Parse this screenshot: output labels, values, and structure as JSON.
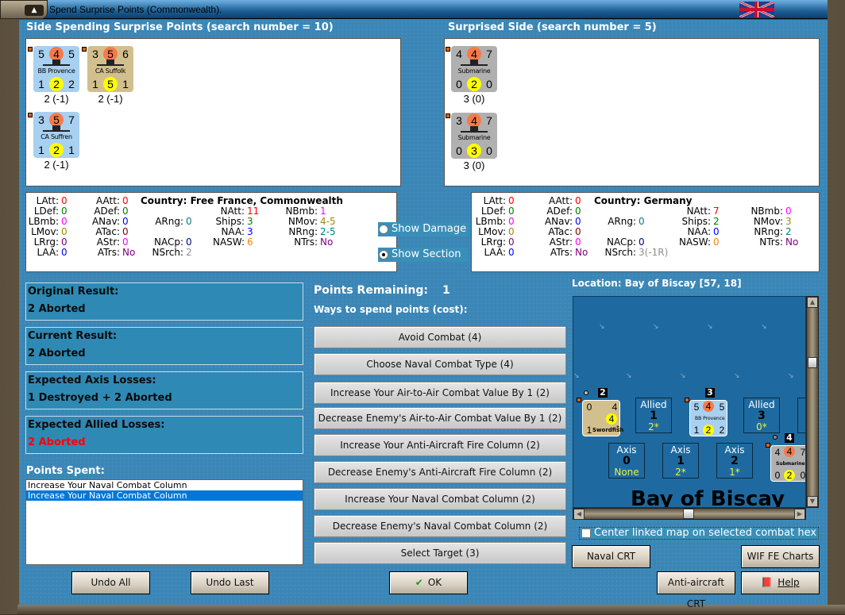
{
  "window": {
    "title": "Spend Surprise Points (Commonwealth)."
  },
  "spending": {
    "heading": "Side Spending Surprise Points (search number = 10)",
    "units": [
      {
        "tl": "5",
        "tm": "4",
        "tr": "5",
        "bl": "1",
        "bm": "2",
        "br": "2",
        "name": "BB Provence",
        "bg": "#a8d0f0",
        "footer": "2 (-1)"
      },
      {
        "tl": "3",
        "tm": "5",
        "tr": "6",
        "bl": "1",
        "bm": "5",
        "br": "1",
        "name": "CA Suffolk",
        "bg": "#d2bf8e",
        "footer": "2 (-1)"
      },
      {
        "tl": "3",
        "tm": "5",
        "tr": "7",
        "bl": "1",
        "bm": "2",
        "br": "1",
        "name": "CA Suffren",
        "bg": "#a8d0f0",
        "footer": "2 (-1)"
      }
    ],
    "country": "Country: Free France, Commonwealth",
    "stats": [
      [
        "LAtt",
        "0",
        "#ff0000"
      ],
      [
        "LDef",
        "0",
        "#008000"
      ],
      [
        "LBmb",
        "0",
        "#ff00ff"
      ],
      [
        "LMov",
        "0",
        "#a08a00"
      ],
      [
        "LRrg",
        "0",
        "#800080"
      ],
      [
        "LAA",
        "0",
        "#0000ff"
      ],
      [
        "AAtt",
        "0",
        "#ff0000"
      ],
      [
        "ADef",
        "0",
        "#008000"
      ],
      [
        "ANav",
        "0",
        "#0000ff"
      ],
      [
        "ATac",
        "0",
        "#800000"
      ],
      [
        "AStr",
        "0",
        "#ff00ff"
      ],
      [
        "ATrs",
        "No",
        "#800080"
      ],
      [
        "ARng",
        "0",
        "#008080"
      ],
      [
        "NACp",
        "0",
        "#000080"
      ],
      [
        "NSrch",
        "2",
        "#909090"
      ],
      [
        "NAtt",
        "11",
        "#ff0000"
      ],
      [
        "Ships",
        "3",
        "#008000"
      ],
      [
        "NAA",
        "3",
        "#0000ff"
      ],
      [
        "NASW",
        "6",
        "#ff8000"
      ],
      [
        "NBmb",
        "1",
        "#ff00ff"
      ],
      [
        "NMov",
        "4-5",
        "#a08a00"
      ],
      [
        "NRng",
        "2-5",
        "#008080"
      ],
      [
        "NTrs",
        "No",
        "#800080"
      ]
    ]
  },
  "surprised": {
    "heading": "Surprised Side (search number = 5)",
    "units": [
      {
        "tl": "4",
        "tm": "4",
        "tr": "7",
        "bl": "0",
        "bm": "2",
        "br": "0",
        "name": "Submarine",
        "bg": "#b0b0b0",
        "footer": "3 (0)"
      },
      {
        "tl": "3",
        "tm": "4",
        "tr": "7",
        "bl": "0",
        "bm": "3",
        "br": "0",
        "name": "Submarine",
        "bg": "#b0b0b0",
        "footer": "3 (0)"
      }
    ],
    "country": "Country: Germany",
    "stats": [
      [
        "LAtt",
        "0",
        "#ff0000"
      ],
      [
        "LDef",
        "0",
        "#008000"
      ],
      [
        "LBmb",
        "0",
        "#ff00ff"
      ],
      [
        "LMov",
        "0",
        "#a08a00"
      ],
      [
        "LRrg",
        "0",
        "#800080"
      ],
      [
        "LAA",
        "0",
        "#0000ff"
      ],
      [
        "AAtt",
        "0",
        "#ff0000"
      ],
      [
        "ADef",
        "0",
        "#008000"
      ],
      [
        "ANav",
        "0",
        "#0000ff"
      ],
      [
        "ATac",
        "0",
        "#800000"
      ],
      [
        "AStr",
        "0",
        "#ff00ff"
      ],
      [
        "ATrs",
        "No",
        "#800080"
      ],
      [
        "ARng",
        "0",
        "#008080"
      ],
      [
        "NACp",
        "0",
        "#000080"
      ],
      [
        "NSrch",
        "3(-1R)",
        "#909090"
      ],
      [
        "NAtt",
        "7",
        "#ff0000"
      ],
      [
        "Ships",
        "2",
        "#008000"
      ],
      [
        "NAA",
        "0",
        "#0000ff"
      ],
      [
        "NASW",
        "0",
        "#ff8000"
      ],
      [
        "NBmb",
        "0",
        "#ff00ff"
      ],
      [
        "NMov",
        "3",
        "#a08a00"
      ],
      [
        "NRng",
        "2",
        "#008080"
      ],
      [
        "NTrs",
        "No",
        "#800080"
      ]
    ]
  },
  "view": {
    "show_damage": "Show Damage",
    "show_section": "Show Section",
    "selected": "Show Section"
  },
  "results": [
    {
      "label": "Original Result:",
      "value": "2 Aborted",
      "color": "#0a0a0a"
    },
    {
      "label": "Current Result:",
      "value": "2 Aborted",
      "color": "#0a0a0a"
    },
    {
      "label": "Expected Axis Losses:",
      "value": "1 Destroyed + 2 Aborted",
      "color": "#0a0a0a"
    },
    {
      "label": "Expected Allied Losses:",
      "value": "2 Aborted",
      "color": "#ff0000"
    }
  ],
  "points_spent": {
    "label": "Points Spent:",
    "items": [
      "Increase Your Naval Combat Column",
      "Increase Your Naval Combat Column"
    ],
    "selected_index": 1
  },
  "spend": {
    "remaining_label": "Points Remaining:",
    "remaining": "1",
    "ways_label": "Ways to spend points (cost):",
    "options": [
      "Avoid Combat (4)",
      "Choose Naval Combat Type (4)",
      "Increase Your Air-to-Air Combat Value By 1 (2)",
      "Decrease Enemy's Air-to-Air Combat Value By 1 (2)",
      "Increase Your Anti-Aircraft Fire Column (2)",
      "Decrease Enemy's Anti-Aircraft Fire Column (2)",
      "Increase Your Naval Combat Column (2)",
      "Decrease Enemy's Naval Combat Column (2)",
      "Select Target (3)"
    ]
  },
  "map": {
    "location": "Location: Bay of Biscay [57, 18]",
    "sea_name": "Bay of Biscay",
    "allied_boxes": [
      {
        "side": "Allied",
        "num": "1",
        "val": "2*"
      },
      {
        "side": "Allied",
        "num": "3",
        "val": "0*"
      }
    ],
    "axis_boxes": [
      {
        "side": "Axis",
        "num": "0",
        "val": "None"
      },
      {
        "side": "Axis",
        "num": "1",
        "val": "2*"
      },
      {
        "side": "Axis",
        "num": "2",
        "val": "1*"
      }
    ],
    "badges": [
      "2",
      "3",
      "4"
    ],
    "swordfish": {
      "tl": "0",
      "tr": "4",
      "circle": "4",
      "bl": "1",
      "name": "Swordfish",
      "star": "*"
    },
    "provence": {
      "tl": "5",
      "tm": "4",
      "tr": "5",
      "bl": "1",
      "bm": "2",
      "br": "2",
      "name": "BB Provence"
    },
    "submarine": {
      "tl": "4",
      "tm": "4",
      "tr": "7",
      "bl": "0",
      "bm": "2",
      "br": "0",
      "name": "Submarine"
    },
    "center_label": "Center linked map on selected combat hex",
    "center_checked": false
  },
  "buttons": {
    "undo_all": "Undo All",
    "undo_last": "Undo Last",
    "ok": "OK",
    "naval_crt": "Naval CRT",
    "wif_charts": "WIF FE Charts",
    "aa_crt": "Anti-aircraft CRT",
    "help": "Help"
  }
}
